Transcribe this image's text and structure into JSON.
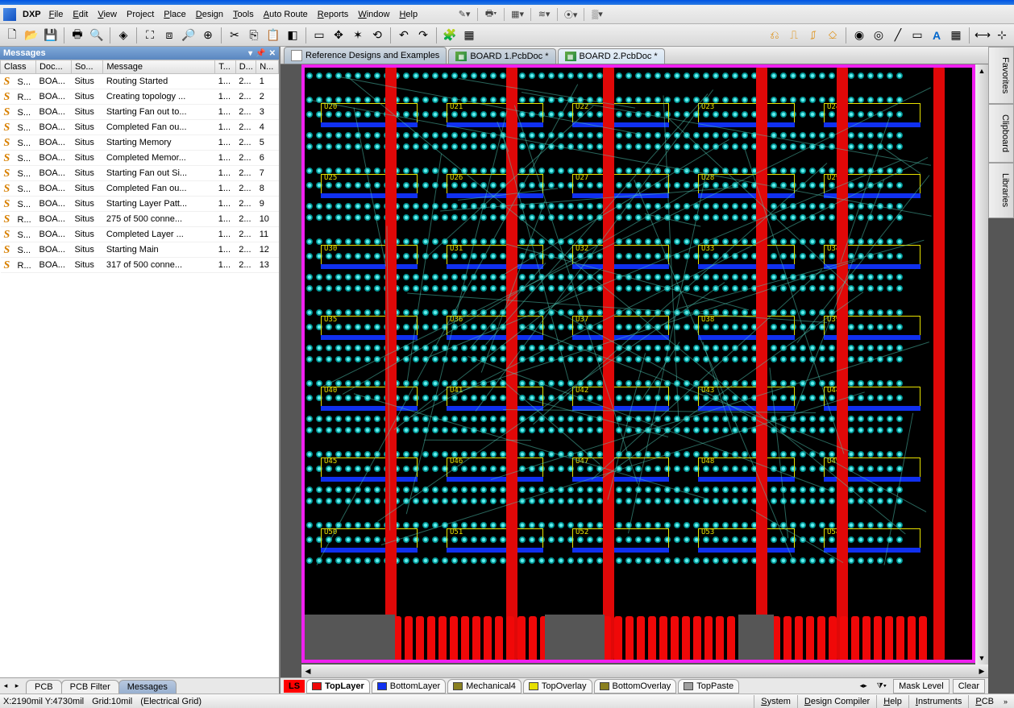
{
  "app": {
    "name": "DXP"
  },
  "menus": [
    "File",
    "Edit",
    "View",
    "Project",
    "Place",
    "Design",
    "Tools",
    "Auto Route",
    "Reports",
    "Window",
    "Help"
  ],
  "messages_panel": {
    "title": "Messages",
    "headers": [
      "Class",
      "Doc...",
      "So...",
      "Message",
      "T...",
      "D...",
      "N..."
    ],
    "rows": [
      {
        "cls": "S...",
        "doc": "BOA...",
        "src": "Situs",
        "msg": "Routing Started",
        "t": "1...",
        "d": "2...",
        "n": "1"
      },
      {
        "cls": "R...",
        "doc": "BOA...",
        "src": "Situs",
        "msg": "Creating topology ...",
        "t": "1...",
        "d": "2...",
        "n": "2"
      },
      {
        "cls": "S...",
        "doc": "BOA...",
        "src": "Situs",
        "msg": "Starting Fan out to...",
        "t": "1...",
        "d": "2...",
        "n": "3"
      },
      {
        "cls": "S...",
        "doc": "BOA...",
        "src": "Situs",
        "msg": "Completed Fan ou...",
        "t": "1...",
        "d": "2...",
        "n": "4"
      },
      {
        "cls": "S...",
        "doc": "BOA...",
        "src": "Situs",
        "msg": "Starting Memory",
        "t": "1...",
        "d": "2...",
        "n": "5"
      },
      {
        "cls": "S...",
        "doc": "BOA...",
        "src": "Situs",
        "msg": "Completed Memor...",
        "t": "1...",
        "d": "2...",
        "n": "6"
      },
      {
        "cls": "S...",
        "doc": "BOA...",
        "src": "Situs",
        "msg": "Starting Fan out Si...",
        "t": "1...",
        "d": "2...",
        "n": "7"
      },
      {
        "cls": "S...",
        "doc": "BOA...",
        "src": "Situs",
        "msg": "Completed Fan ou...",
        "t": "1...",
        "d": "2...",
        "n": "8"
      },
      {
        "cls": "S...",
        "doc": "BOA...",
        "src": "Situs",
        "msg": "Starting Layer Patt...",
        "t": "1...",
        "d": "2...",
        "n": "9"
      },
      {
        "cls": "R...",
        "doc": "BOA...",
        "src": "Situs",
        "msg": "275 of 500 conne...",
        "t": "1...",
        "d": "2...",
        "n": "10"
      },
      {
        "cls": "S...",
        "doc": "BOA...",
        "src": "Situs",
        "msg": "Completed Layer ...",
        "t": "1...",
        "d": "2...",
        "n": "11"
      },
      {
        "cls": "S...",
        "doc": "BOA...",
        "src": "Situs",
        "msg": "Starting Main",
        "t": "1...",
        "d": "2...",
        "n": "12"
      },
      {
        "cls": "R...",
        "doc": "BOA...",
        "src": "Situs",
        "msg": "317 of 500 conne...",
        "t": "1...",
        "d": "2...",
        "n": "13"
      }
    ]
  },
  "sidebar_tabs": [
    "PCB",
    "PCB Filter",
    "Messages"
  ],
  "doc_tabs": [
    {
      "label": "Reference Designs and Examples",
      "active": false,
      "kind": "folder"
    },
    {
      "label": "BOARD 1.PcbDoc *",
      "active": false,
      "kind": "pcb"
    },
    {
      "label": "BOARD 2.PcbDoc *",
      "active": true,
      "kind": "pcb"
    }
  ],
  "right_panes": [
    "Favorites",
    "Clipboard",
    "Libraries"
  ],
  "layers": {
    "ls": "LS",
    "tabs": [
      {
        "label": "TopLayer",
        "color": "#f00808",
        "active": true
      },
      {
        "label": "BottomLayer",
        "color": "#1030f0",
        "active": false
      },
      {
        "label": "Mechanical4",
        "color": "#8a8020",
        "active": false
      },
      {
        "label": "TopOverlay",
        "color": "#e6e000",
        "active": false
      },
      {
        "label": "BottomOverlay",
        "color": "#8a8020",
        "active": false
      },
      {
        "label": "TopPaste",
        "color": "#a0a0a0",
        "active": false
      }
    ],
    "mask": "Mask Level",
    "clear": "Clear"
  },
  "status": {
    "coord": "X:2190mil Y:4730mil",
    "grid": "Grid:10mil",
    "mode": "(Electrical Grid)",
    "tabs": [
      "System",
      "Design Compiler",
      "Help",
      "Instruments",
      "PCB"
    ]
  }
}
